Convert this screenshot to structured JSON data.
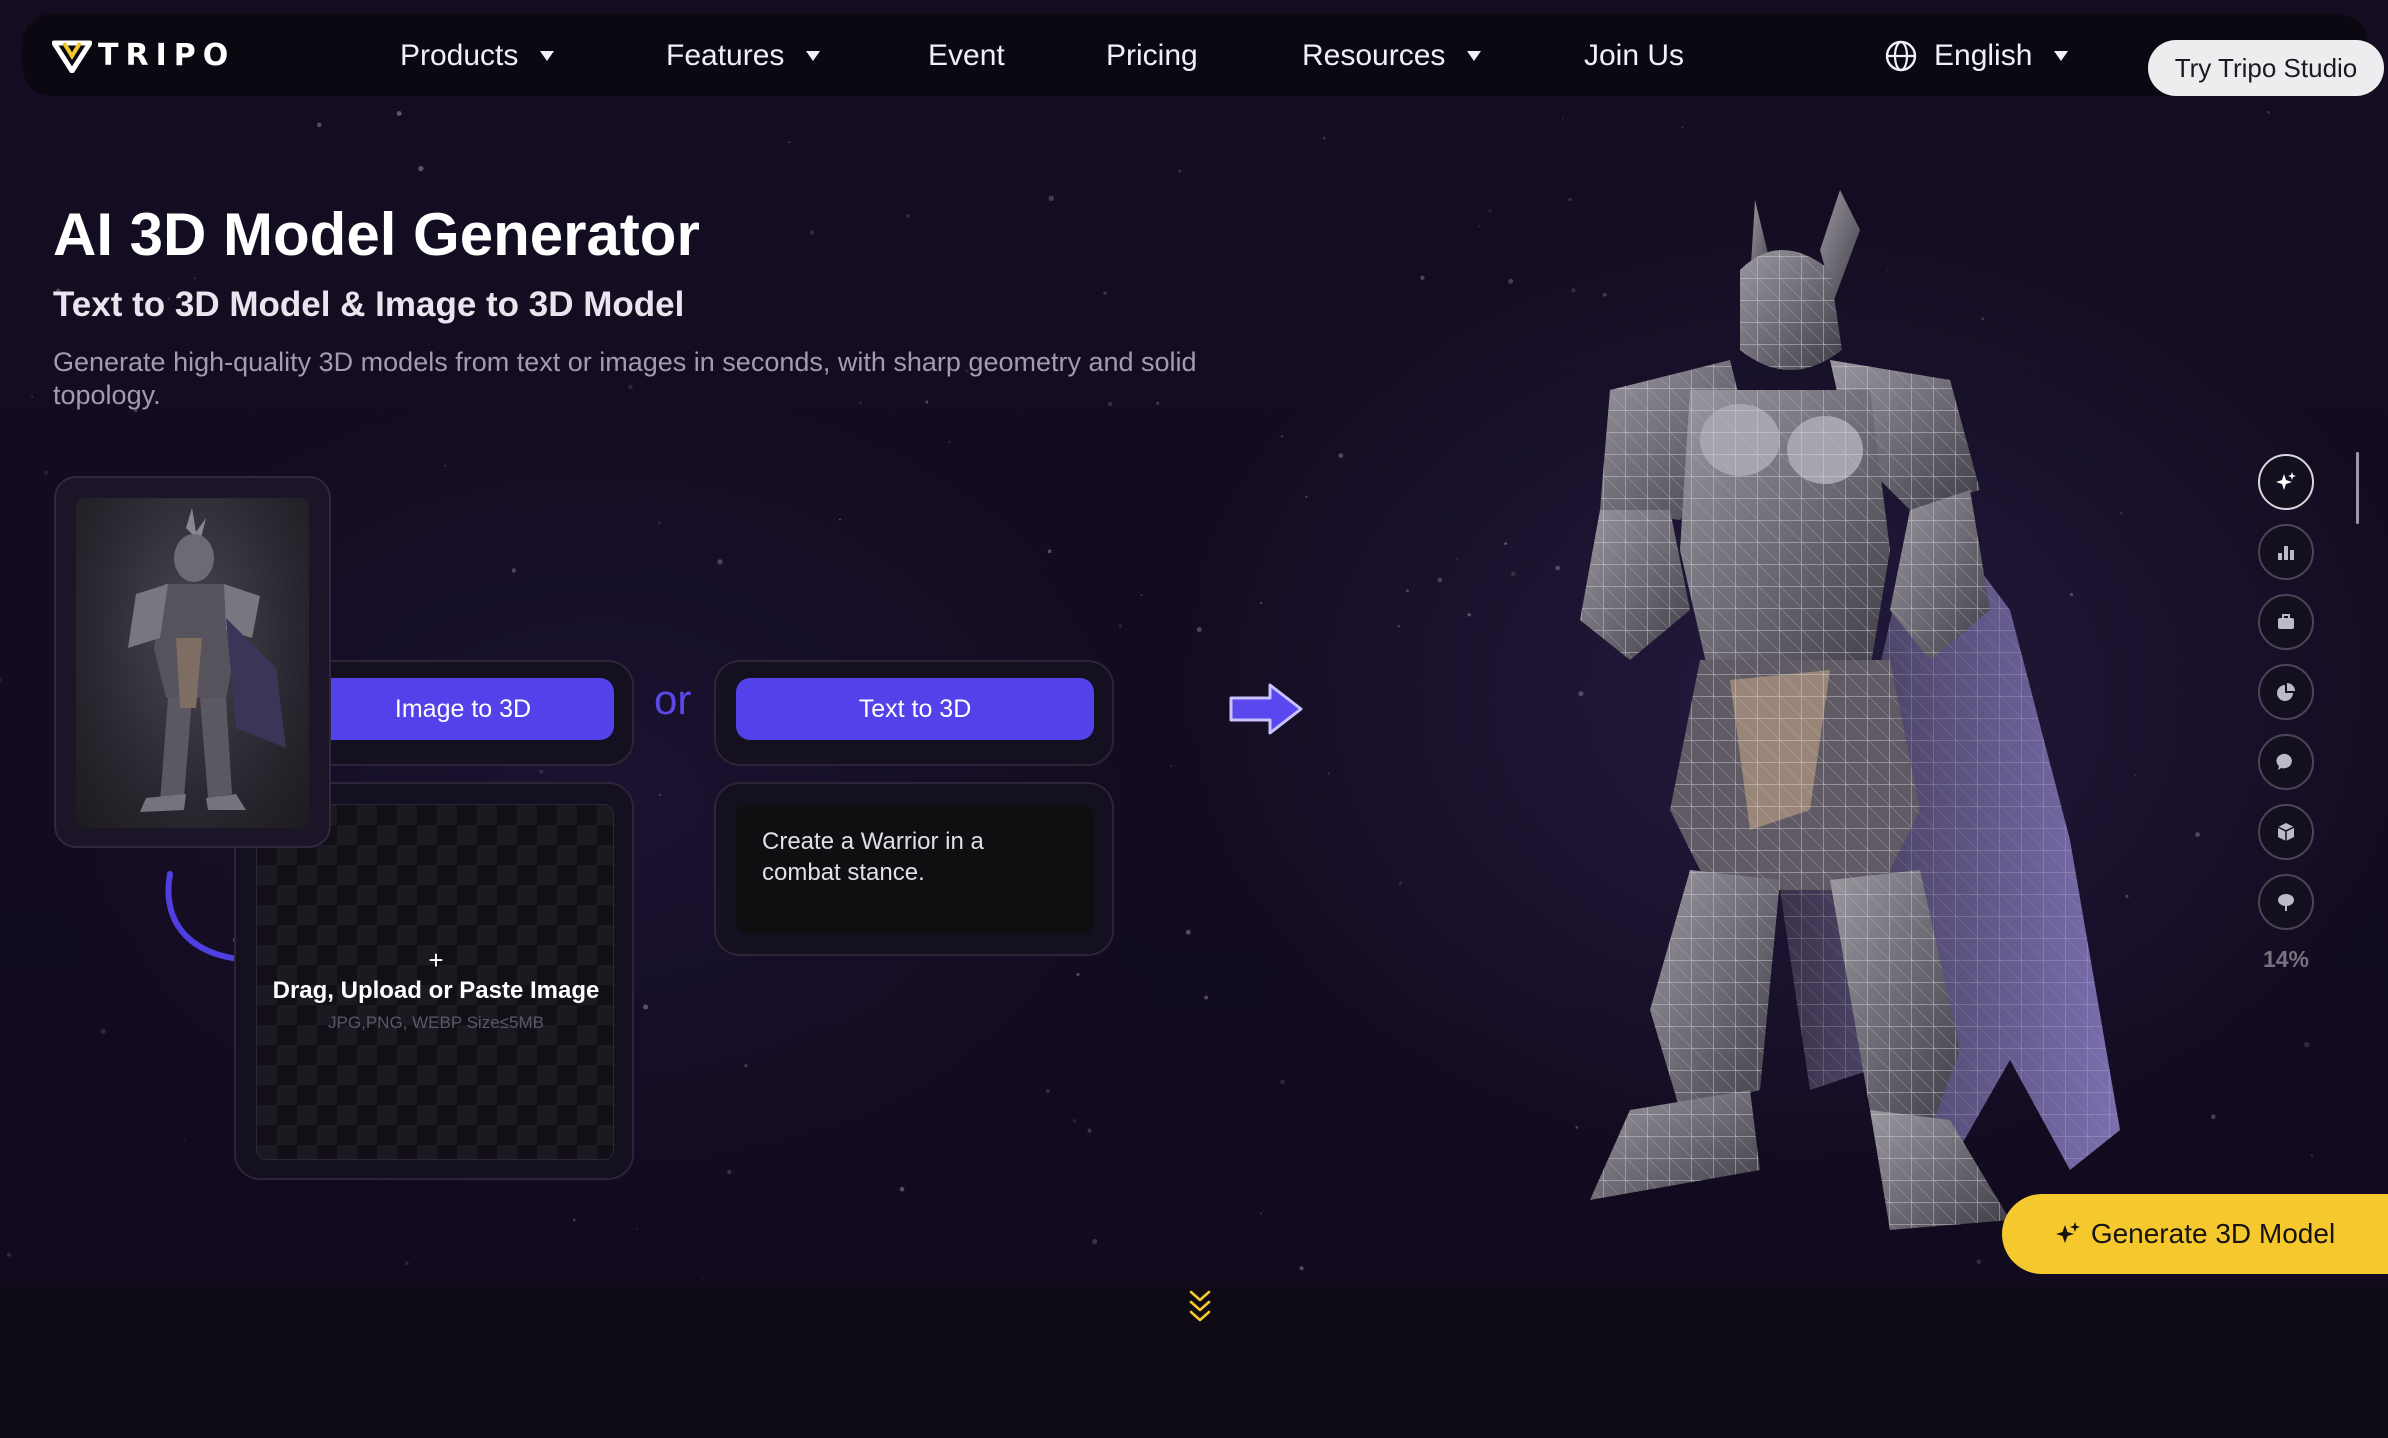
{
  "nav": {
    "brand": "TRIPO",
    "items": [
      {
        "label": "Products",
        "has_dropdown": true
      },
      {
        "label": "Features",
        "has_dropdown": true
      },
      {
        "label": "Event",
        "has_dropdown": false
      },
      {
        "label": "Pricing",
        "has_dropdown": false
      },
      {
        "label": "Resources",
        "has_dropdown": true
      },
      {
        "label": "Join Us",
        "has_dropdown": false
      }
    ],
    "language": "English",
    "cta": "Try Tripo Studio"
  },
  "hero": {
    "title": "AI 3D Model Generator",
    "subtitle": "Text to 3D Model & Image to 3D Model",
    "description": "Generate high-quality 3D models from text or images in seconds, with sharp geometry and solid topology."
  },
  "demo": {
    "image_tab": "Image to 3D",
    "separator": "or",
    "text_tab": "Text to 3D",
    "upload_plus": "+",
    "upload_title": "Drag, Upload or Paste Image",
    "upload_hint": "JPG,PNG, WEBP Size≤5MB",
    "prompt_text": "Create a Warrior in a combat stance."
  },
  "toolbar": {
    "icons": [
      "sparkle-icon",
      "chart-icon",
      "briefcase-icon",
      "pie-icon",
      "chat-icon",
      "cube-icon",
      "tree-icon"
    ],
    "progress": "14%"
  },
  "generate_button": "Generate 3D Model",
  "colors": {
    "accent": "#5341EA",
    "cta_yellow": "#F5C92D",
    "background": "#130C21"
  }
}
